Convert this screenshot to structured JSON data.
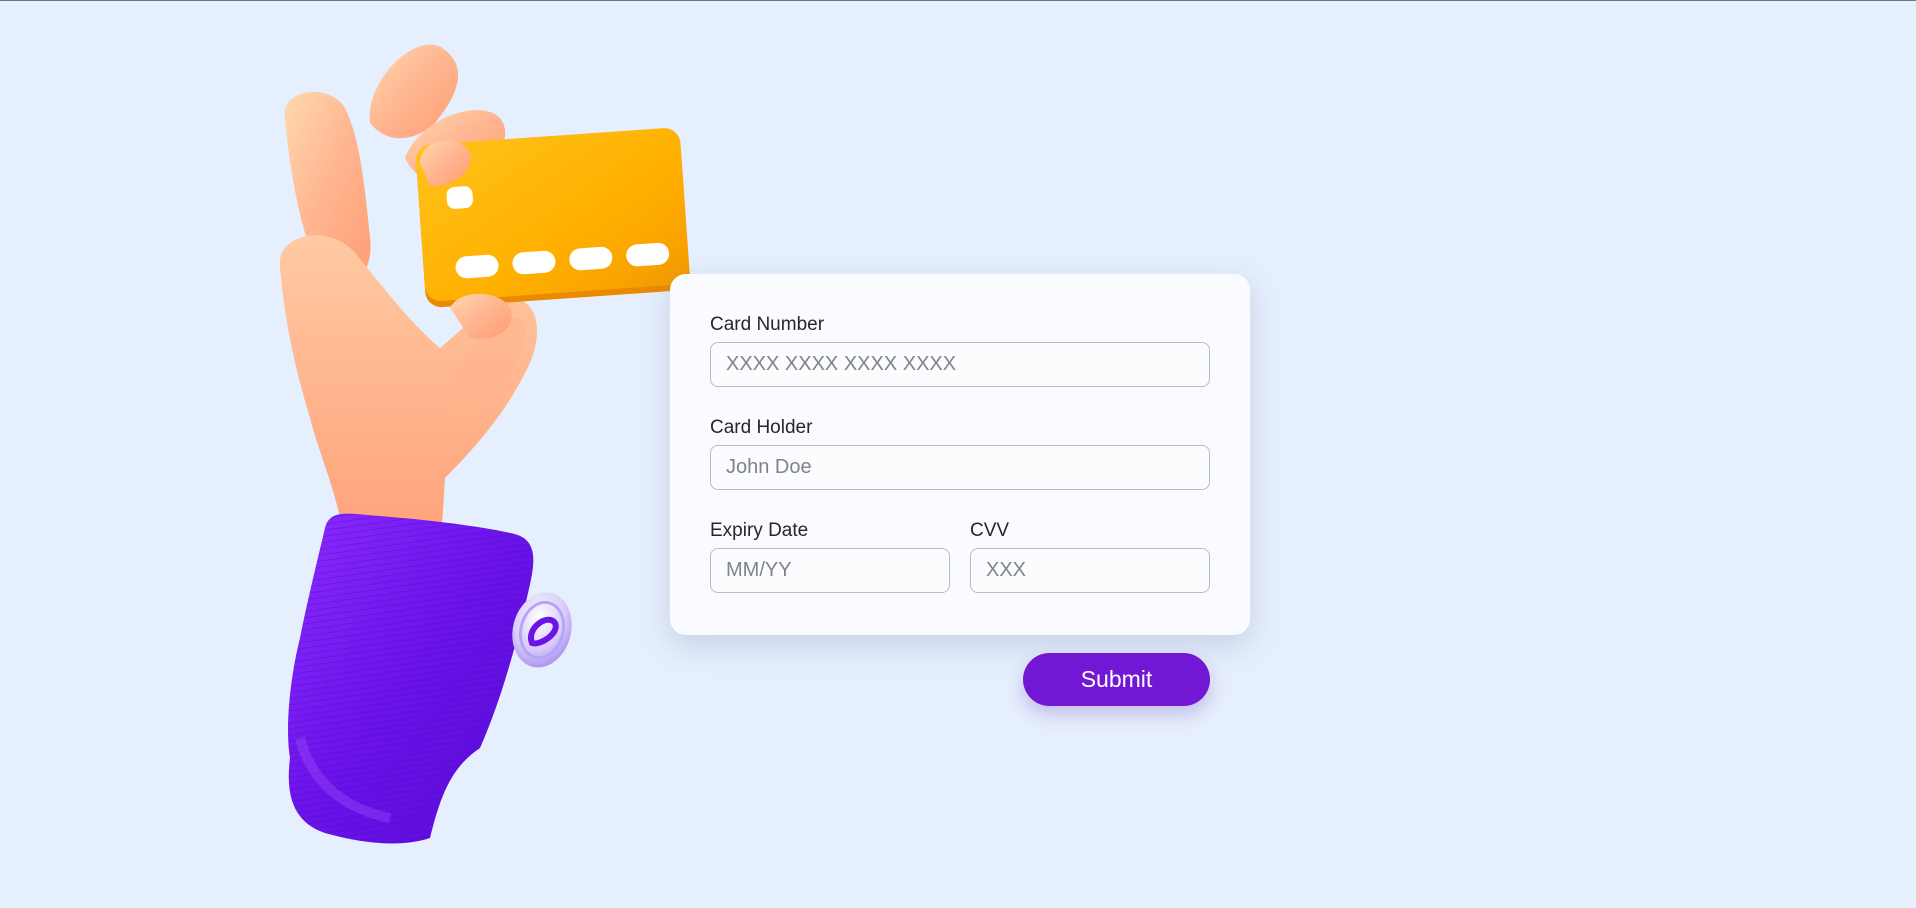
{
  "form": {
    "card_number": {
      "label": "Card Number",
      "placeholder": "XXXX XXXX XXXX XXXX",
      "value": ""
    },
    "card_holder": {
      "label": "Card Holder",
      "placeholder": "John Doe",
      "value": ""
    },
    "expiry_date": {
      "label": "Expiry Date",
      "placeholder": "MM/YY",
      "value": ""
    },
    "cvv": {
      "label": "CVV",
      "placeholder": "XXX",
      "value": ""
    }
  },
  "submit_label": "Submit",
  "colors": {
    "background": "#e6effd",
    "accent": "#7217d4",
    "sleeve": "#7a1cf0",
    "skin": "#ffa77e",
    "card": "#ffb300"
  },
  "icons": {
    "illustration": "hand-holding-credit-card-illustration"
  }
}
